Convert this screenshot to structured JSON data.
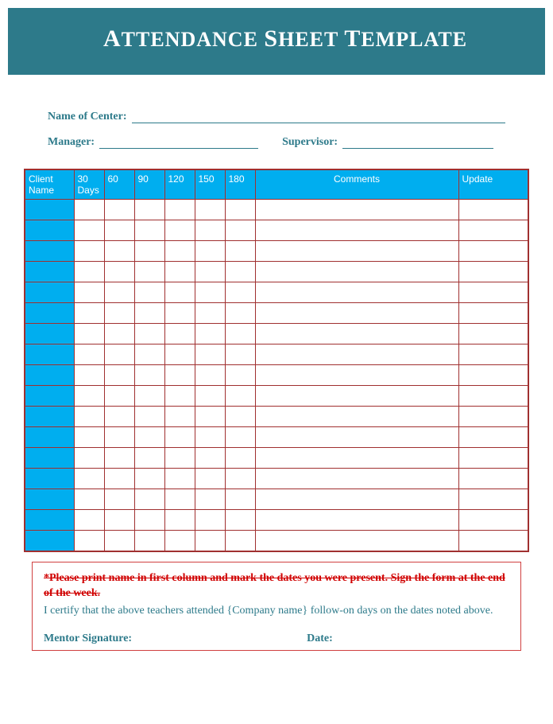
{
  "header": {
    "title_html": "<span class='cap'>A</span>TTENDANCE <span class='cap'>S</span>HEET <span class='cap'>T</span>EMPLATE"
  },
  "fields": {
    "center_label": "Name of Center:",
    "manager_label": "Manager:",
    "supervisor_label": "Supervisor:"
  },
  "table": {
    "headers": {
      "client": "Client Name",
      "d30a": "30",
      "d30b": "Days",
      "d60": "60",
      "d90": "90",
      "d120": "120",
      "d150": "150",
      "d180": "180",
      "comments": "Comments",
      "update": "Update"
    },
    "row_count": 17
  },
  "footer": {
    "strike_note": "*Please print name in first column and mark the dates you were present. Sign the form at the end of the week.",
    "certify": "I certify that the above teachers attended {Company name} follow-on days on the dates noted above.",
    "mentor_label": "Mentor Signature:",
    "date_label": "Date:"
  }
}
